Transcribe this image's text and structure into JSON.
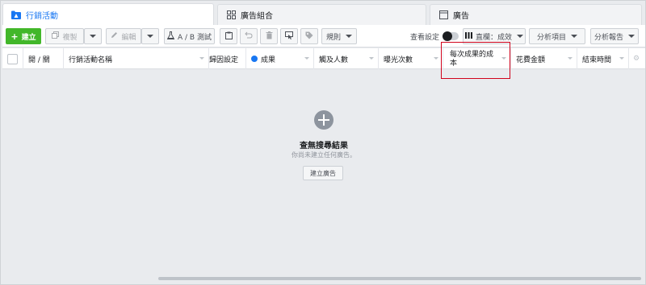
{
  "tabs": [
    {
      "label": "行銷活動",
      "icon": "folder-icon"
    },
    {
      "label": "廣告組合",
      "icon": "grid-icon"
    },
    {
      "label": "廣告",
      "icon": "ad-page-icon"
    }
  ],
  "toolbar": {
    "create": "建立",
    "duplicate": "複製",
    "edit": "編輯",
    "ab_test": "A / B 測試",
    "rules": "規則",
    "view_setting": "查看設定",
    "columns": "直欄：成效",
    "breakdown": "分析項目",
    "reports": "分析報告"
  },
  "table": {
    "columns": [
      "開 / 關",
      "行銷活動名稱",
      "歸因設定",
      "成果",
      "觸及人數",
      "曝光次數",
      "每次成果的成本",
      "花費金額",
      "結束時間"
    ]
  },
  "empty": {
    "title": "查無搜尋結果",
    "subtitle": "你尚未建立任何廣告。",
    "button": "建立廣告"
  },
  "colors": {
    "accent": "#1877f2",
    "create": "#42b72a",
    "highlight": "#d0021b"
  }
}
